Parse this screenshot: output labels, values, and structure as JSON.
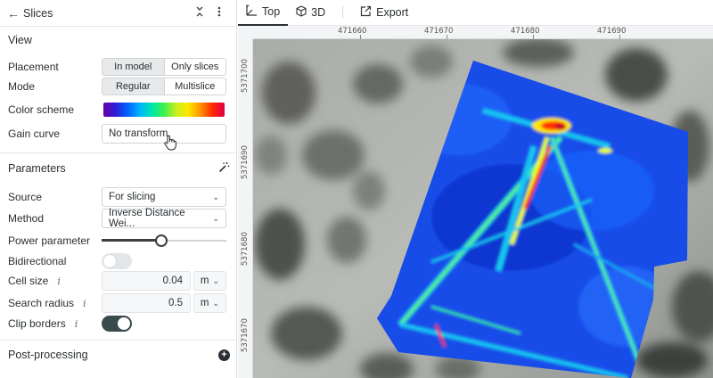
{
  "panel": {
    "title": "Slices",
    "view_section": "View",
    "placement": {
      "label": "Placement",
      "options": [
        "In model",
        "Only slices"
      ],
      "selected": "In model"
    },
    "mode": {
      "label": "Mode",
      "options": [
        "Regular",
        "Multislice"
      ],
      "selected": "Regular"
    },
    "color_scheme": {
      "label": "Color scheme"
    },
    "gain_curve": {
      "label": "Gain curve",
      "value": "No transform"
    },
    "parameters_section": "Parameters",
    "source": {
      "label": "Source",
      "value": "For slicing"
    },
    "method": {
      "label": "Method",
      "value": "Inverse Distance Wei..."
    },
    "power": {
      "label": "Power parameter",
      "level": 0.48
    },
    "bidirectional": {
      "label": "Bidirectional",
      "on": false
    },
    "cell_size": {
      "label": "Cell size",
      "value": "0.04",
      "unit": "m"
    },
    "search_radius": {
      "label": "Search radius",
      "value": "0.5",
      "unit": "m"
    },
    "clip_borders": {
      "label": "Clip borders",
      "on": true
    },
    "post_section": "Post-processing"
  },
  "toolbar": {
    "tab_top": "Top",
    "tab_3d": "3D",
    "export": "Export"
  },
  "map": {
    "x_ticks": [
      "471660",
      "471670",
      "471680",
      "471690"
    ],
    "y_ticks": [
      "5371700",
      "5371690",
      "5371680",
      "5371670"
    ]
  },
  "colors": {
    "accent": "#2a2f33",
    "scheme_start": "#6a00a8",
    "scheme_end": "#e0004a"
  }
}
